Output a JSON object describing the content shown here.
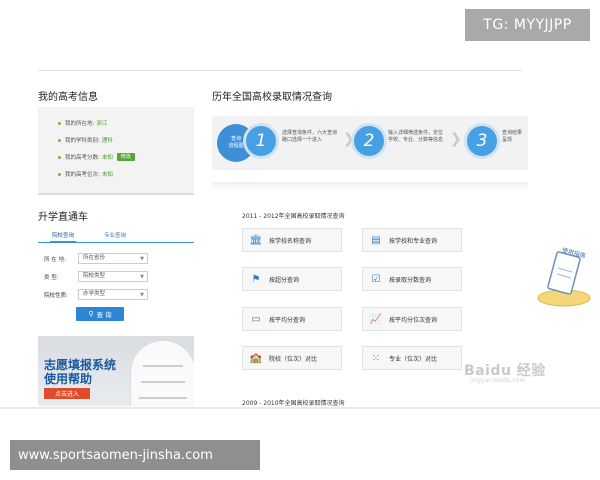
{
  "watermark_top": "TG: MYYJJPP",
  "left": {
    "title": "我的高考信息",
    "info": [
      {
        "label": "我的所在地:",
        "value": "浙江"
      },
      {
        "label": "我的学科类别:",
        "value": "理科"
      },
      {
        "label": "我的高考分数:",
        "value": "未知",
        "button": "修改"
      },
      {
        "label": "我的高考位次:",
        "value": "未知"
      }
    ],
    "lift_title": "升学直通车",
    "tabs": [
      "院校查询",
      "专业查询"
    ],
    "form": [
      {
        "label": "所 在 地:",
        "value": "所在省份"
      },
      {
        "label": "类    型:",
        "value": "院校类型"
      },
      {
        "label": "院校性质:",
        "value": "办学类型"
      }
    ],
    "query_button": "查 询",
    "banner": {
      "line1": "志愿填报系统",
      "line2": "使用帮助",
      "button": "点击进入"
    }
  },
  "right": {
    "title": "历年全国高校录取情况查询",
    "steps_start": "查询\n流程图",
    "steps": [
      {
        "num": "1",
        "text": "选择查询条件，六大查询路口选择一个进入"
      },
      {
        "num": "2",
        "text": "输入详细筛选条件，定位学校、专业、分数等信息"
      },
      {
        "num": "3",
        "text": "查询结果呈现"
      }
    ],
    "section1": "2011 - 2012年全国高校录取情况查询",
    "buttons": [
      {
        "label": "按学校名称查询",
        "icon": "building-icon"
      },
      {
        "label": "按学校和专业查询",
        "icon": "document-icon"
      },
      {
        "label": "按超分查询",
        "icon": "flag-icon"
      },
      {
        "label": "按录取分数查询",
        "icon": "checkbox-icon"
      },
      {
        "label": "按平均分查询",
        "icon": "monitor-icon"
      },
      {
        "label": "按平均分位次查询",
        "icon": "trend-chart-icon"
      },
      {
        "label": "院校（位次）对比",
        "icon": "school-icon"
      },
      {
        "label": "专业（位次）对比",
        "icon": "grid-icon"
      }
    ],
    "section2": "2009 - 2010年全国高校录取情况查询"
  },
  "baidu_logo": "Baidu 经验",
  "baidu_url": "jingyan.baidu.com",
  "sticker": "使用指南",
  "footer": "www.sportsaomen-jinsha.com"
}
